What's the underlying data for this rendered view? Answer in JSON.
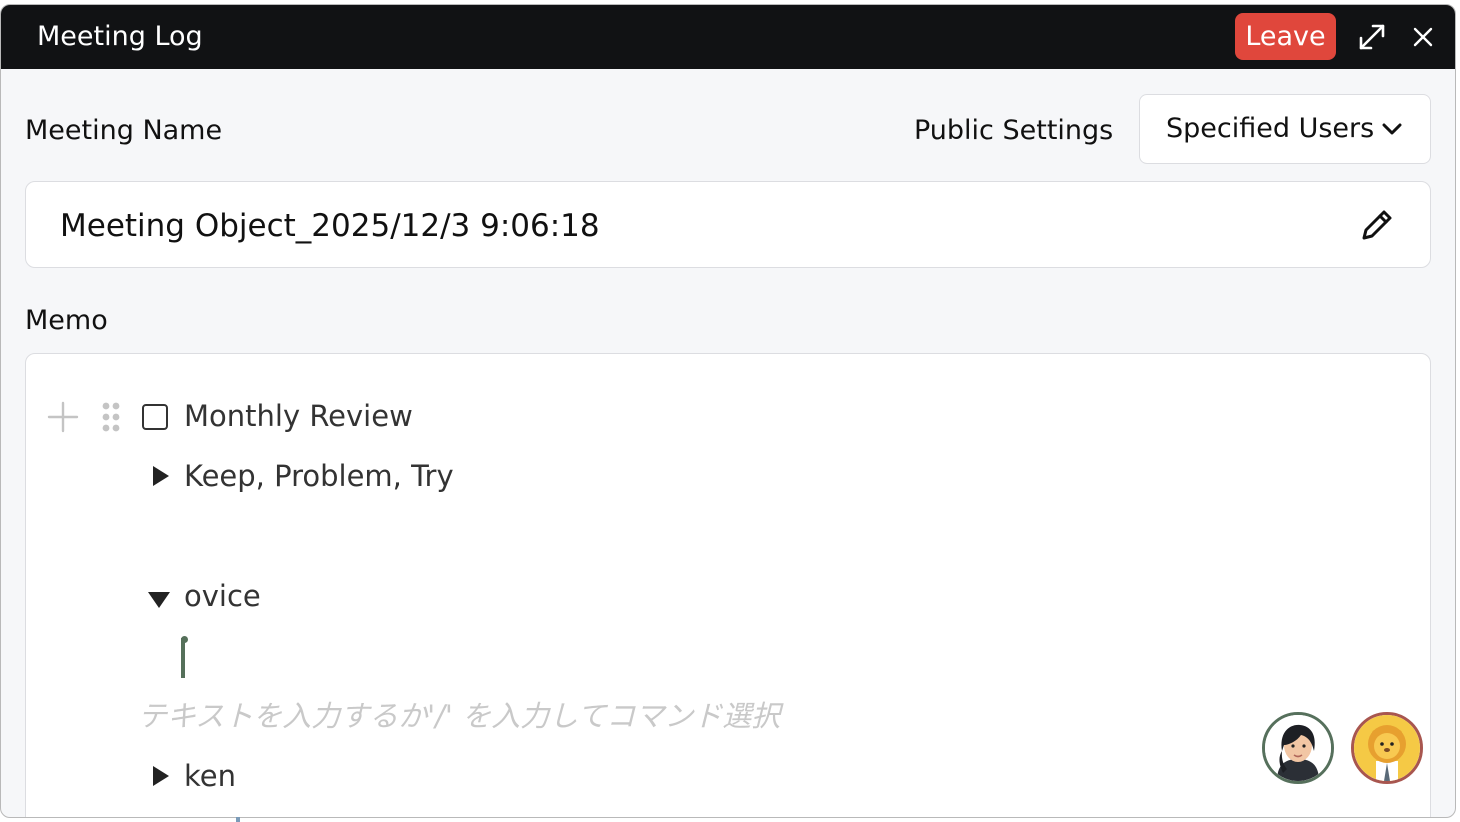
{
  "window": {
    "title": "Meeting Log",
    "leave_label": "Leave",
    "expand_icon": "expand-icon",
    "close_icon": "close-icon",
    "accent_color": "#e0473c"
  },
  "form": {
    "meeting_name_label": "Meeting Name",
    "public_settings_label": "Public Settings",
    "public_settings_value": "Specified Users",
    "meeting_name_value": "Meeting Object_2025/12/3 9:06:18",
    "memo_label": "Memo"
  },
  "memo": {
    "items": [
      {
        "type": "checkbox",
        "text": "Monthly Review",
        "checked": false
      },
      {
        "type": "toggle-collapsed",
        "text": "Keep, Problem, Try"
      },
      {
        "type": "toggle-expanded",
        "text": "ovice"
      },
      {
        "type": "toggle-collapsed",
        "text": "ken"
      }
    ],
    "placeholder": "テキストを入力するか'/' を入力してコマンド選択"
  },
  "participants": [
    {
      "name": "avatar-woman",
      "ring_color": "#56705c"
    },
    {
      "name": "avatar-lion",
      "ring_color": "#a8564f"
    }
  ]
}
